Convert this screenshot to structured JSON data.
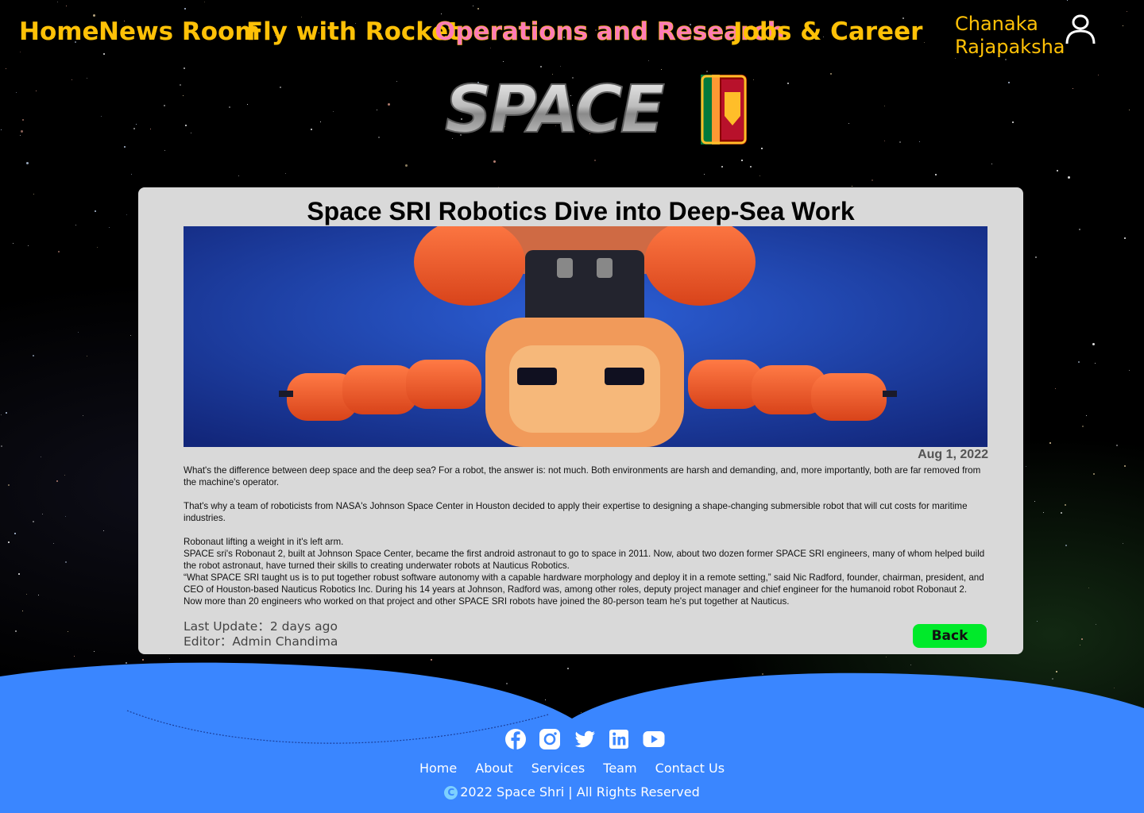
{
  "nav": {
    "items": [
      {
        "label": "Home"
      },
      {
        "label": "News Room"
      },
      {
        "label": "Fly with Rocket"
      },
      {
        "label": "Operations and Research",
        "active": true
      },
      {
        "label": "Jobs & Career"
      }
    ],
    "user": {
      "first": "Chanaka",
      "last": "Rajapaksha",
      "icon": "user-icon"
    }
  },
  "logo": {
    "text": "SPACE"
  },
  "article": {
    "title": "Space SRI Robotics Dive into Deep-Sea Work",
    "date": "Aug 1, 2022",
    "paragraphs": [
      "What's the difference between deep space and the deep sea? For a robot, the answer is: not much. Both environments are harsh and demanding, and, more importantly, both are far removed from the machine's operator.",
      "That's why a team of roboticists from NASA's Johnson Space Center in Houston decided to apply their expertise to designing a shape-changing submersible robot that will cut costs for maritime industries.",
      "Robonaut lifting a weight in it's left arm.",
      "SPACE sri's Robonaut 2, built at Johnson Space Center, became the first android astronaut to go to space in 2011. Now, about two dozen former SPACE SRI  engineers, many of whom helped build the robot astronaut, have turned their skills to creating underwater robots at Nauticus Robotics.",
      "“What SPACE SRI taught us is to put together robust software autonomy with a capable hardware morphology and deploy it in a remote setting,” said Nic Radford, founder, chairman, president, and CEO of Houston-based Nauticus Robotics Inc. During his 14 years at Johnson, Radford was, among other roles, deputy project manager and chief engineer for the humanoid robot Robonaut 2. Now more than 20 engineers who worked on that project and other SPACE SRI  robots have joined the 80-person team he's put together at Nauticus."
    ],
    "last_update": "Last Update：2 days ago",
    "editor": "Editor：Admin Chandima",
    "back_label": "Back"
  },
  "footer": {
    "social": [
      "facebook-icon",
      "instagram-icon",
      "twitter-icon",
      "linkedin-icon",
      "youtube-icon"
    ],
    "links": [
      "Home",
      "About",
      "Services",
      "Team",
      "Contact Us"
    ],
    "copyright_badge": "C",
    "copyright": "2022 Space Shri | All Rights Reserved"
  },
  "colors": {
    "nav": "#ffc107",
    "nav_active": "#ff7bb8",
    "card": "#d9d9d9",
    "back_button": "#00ea2a",
    "footer": "#3a86ff"
  }
}
